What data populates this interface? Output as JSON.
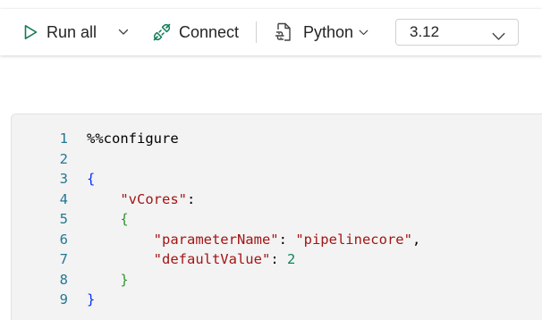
{
  "toolbar": {
    "run_all_label": "Run all",
    "connect_label": "Connect",
    "language_label": "Python",
    "version_value": "3.12"
  },
  "icons": {
    "run": "play-icon",
    "run_dropdown": "chevron-down-icon",
    "connect": "plug-connect-icon",
    "language": "python-file-icon",
    "language_dropdown": "chevron-down-icon",
    "version_dropdown": "chevron-down-icon"
  },
  "colors": {
    "accent": "#0f7b56",
    "line_number": "#237893",
    "string": "#a31515",
    "number": "#098658",
    "brace_outer": "#0431fa",
    "brace_inner": "#319331"
  },
  "editor": {
    "lines": [
      {
        "number": "1",
        "tokens": [
          {
            "text": "%%configure",
            "kind": "plain"
          }
        ]
      },
      {
        "number": "2",
        "tokens": []
      },
      {
        "number": "3",
        "tokens": [
          {
            "text": "{",
            "kind": "brace-blue"
          }
        ]
      },
      {
        "number": "4",
        "tokens": [
          {
            "text": "    ",
            "kind": "plain"
          },
          {
            "text": "\"vCores\"",
            "kind": "key"
          },
          {
            "text": ":",
            "kind": "punct"
          }
        ]
      },
      {
        "number": "5",
        "tokens": [
          {
            "text": "    ",
            "kind": "plain"
          },
          {
            "text": "{",
            "kind": "brace-green"
          }
        ]
      },
      {
        "number": "6",
        "tokens": [
          {
            "text": "        ",
            "kind": "plain"
          },
          {
            "text": "\"parameterName\"",
            "kind": "key"
          },
          {
            "text": ": ",
            "kind": "punct"
          },
          {
            "text": "\"pipelinecore\"",
            "kind": "str"
          },
          {
            "text": ",",
            "kind": "punct"
          }
        ]
      },
      {
        "number": "7",
        "tokens": [
          {
            "text": "        ",
            "kind": "plain"
          },
          {
            "text": "\"defaultValue\"",
            "kind": "key"
          },
          {
            "text": ": ",
            "kind": "punct"
          },
          {
            "text": "2",
            "kind": "num"
          }
        ]
      },
      {
        "number": "8",
        "tokens": [
          {
            "text": "    ",
            "kind": "plain"
          },
          {
            "text": "}",
            "kind": "brace-green"
          }
        ]
      },
      {
        "number": "9",
        "tokens": [
          {
            "text": "}",
            "kind": "brace-blue"
          }
        ]
      }
    ]
  }
}
